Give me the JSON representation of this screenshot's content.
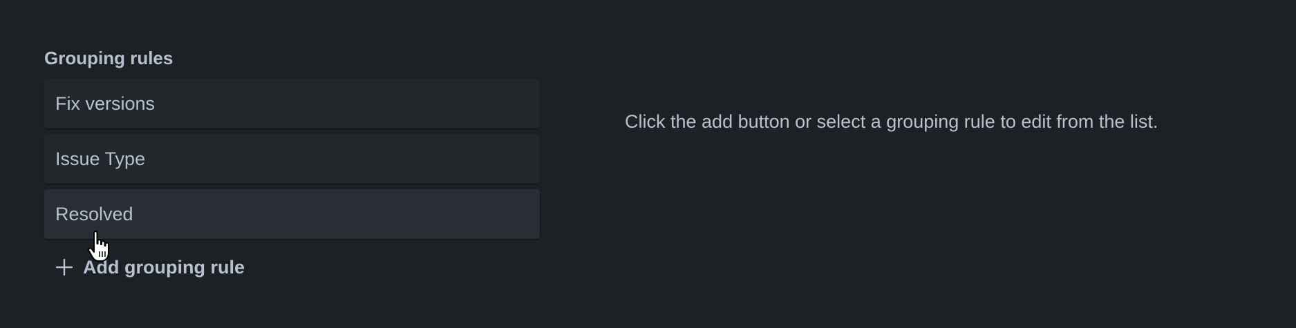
{
  "grouping": {
    "title": "Grouping rules",
    "rules": [
      {
        "label": "Fix versions"
      },
      {
        "label": "Issue Type"
      },
      {
        "label": "Resolved"
      }
    ],
    "add_label": "Add grouping rule",
    "add_icon": "plus-icon"
  },
  "detail": {
    "empty_message": "Click the add button or select a grouping rule to edit from the list."
  },
  "colors": {
    "background": "#1d2025",
    "card": "#22272b",
    "card_hover": "#282e33",
    "text": "#b6c2cf"
  }
}
